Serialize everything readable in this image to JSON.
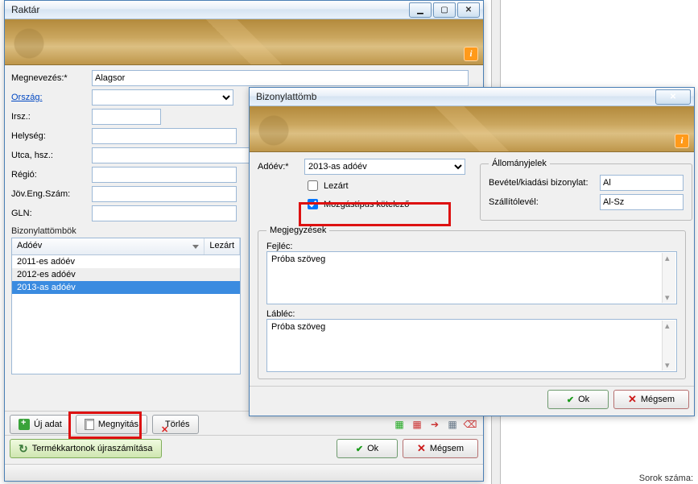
{
  "raktar": {
    "title": "Raktár",
    "labels": {
      "megnevezes": "Megnevezés:*",
      "orszag": "Ország:",
      "irsz": "Irsz.:",
      "helyseg": "Helység:",
      "utca": "Utca, hsz.:",
      "regio": "Régió:",
      "jov": "Jöv.Eng.Szám:",
      "gln": "GLN:",
      "bizlist": "Bizonylattömbök"
    },
    "values": {
      "megnevezes": "Alagsor"
    },
    "grid": {
      "col_adoev": "Adóév",
      "col_lezart": "Lezárt",
      "rows": [
        "2011-es adóév",
        "2012-es adóév",
        "2013-as adóév"
      ],
      "selected_index": 2
    },
    "buttons": {
      "uj": "Új adat",
      "megnyit": "Megnyitás",
      "torles": "Törlés",
      "recalc": "Termékkartonok újraszámítása",
      "ok": "Ok",
      "megsem": "Mégsem"
    }
  },
  "biz": {
    "title": "Bizonylattömb",
    "labels": {
      "adoev": "Adóév:*",
      "lezart": "Lezárt",
      "mozgas": "Mozgástípus kötelező",
      "allomany": "Állományjelek",
      "bevkiad": "Bevétel/kiadási bizonylat:",
      "szall": "Szállítólevél:",
      "megj": "Megjegyzések",
      "fejlec": "Fejléc:",
      "lablec": "Lábléc:"
    },
    "values": {
      "adoev": "2013-as adóév",
      "bevkiad": "Al",
      "szall": "Al-Sz",
      "fejlec": "Próba szöveg",
      "lablec": "Próba szöveg"
    },
    "buttons": {
      "ok": "Ok",
      "megsem": "Mégsem"
    }
  },
  "status": {
    "sorok": "Sorok száma:"
  }
}
